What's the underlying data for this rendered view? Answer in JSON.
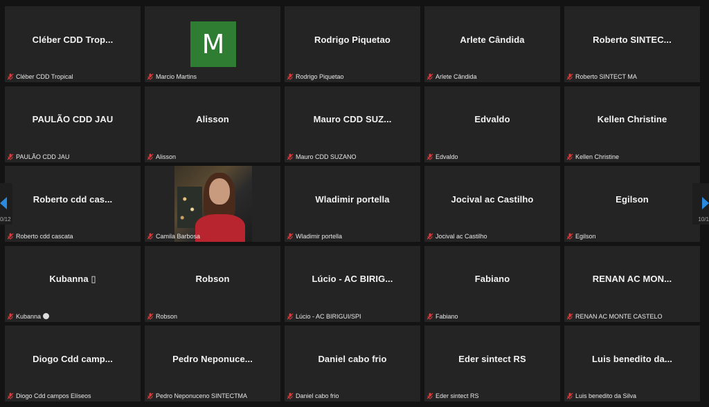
{
  "participants": [
    {
      "title": "Cléber CDD Trop...",
      "label": "Cléber CDD Tropical",
      "muted": true
    },
    {
      "title": "",
      "label": "Marcio Martins",
      "muted": true,
      "avatar_letter": "M",
      "avatar_color": "#2e7d32"
    },
    {
      "title": "Rodrigo Piquetao",
      "label": "Rodrigo Piquetao",
      "muted": true
    },
    {
      "title": "Arlete Cândida",
      "label": "Arlete Cândida",
      "muted": true
    },
    {
      "title": "Roberto  SINTEC...",
      "label": "Roberto SINTECT MA",
      "muted": true
    },
    {
      "title": "PAULÃO CDD JAU",
      "label": "PAULÃO CDD JAU",
      "muted": true
    },
    {
      "title": "Alisson",
      "label": "Alisson",
      "muted": true
    },
    {
      "title": "Mauro  CDD  SUZ...",
      "label": "Mauro CDD SUZANO",
      "muted": true
    },
    {
      "title": "Edvaldo",
      "label": "Edvaldo",
      "muted": true
    },
    {
      "title": "Kellen Christine",
      "label": "Kellen Christine",
      "muted": true
    },
    {
      "title": "Roberto cdd cas...",
      "label": "Roberto cdd cascata",
      "muted": true
    },
    {
      "title": "",
      "label": "Camila Barbosa",
      "muted": true,
      "video": true
    },
    {
      "title": "Wladimir portella",
      "label": "Wladimir portella",
      "muted": true
    },
    {
      "title": "Jocival ac Castilho",
      "label": "Jocival ac Castilho",
      "muted": true
    },
    {
      "title": "Egilson",
      "label": "Egilson",
      "muted": true
    },
    {
      "title": "Kubanna ▯",
      "label": "Kubanna",
      "muted": true,
      "badge": true
    },
    {
      "title": "Robson",
      "label": "Robson",
      "muted": true
    },
    {
      "title": "Lúcio - AC BIRIG...",
      "label": "Lúcio - AC BIRIGUI/SPI",
      "muted": true
    },
    {
      "title": "Fabiano",
      "label": "Fabiano",
      "muted": true
    },
    {
      "title": "RENAN  AC  MON...",
      "label": "RENAN AC MONTE CASTELO",
      "muted": true
    },
    {
      "title": "Diogo  Cdd  camp...",
      "label": "Diogo Cdd campos Elíseos",
      "muted": true
    },
    {
      "title": "Pedro  Neponuce...",
      "label": "Pedro Neponuceno SINTECTMA",
      "muted": true
    },
    {
      "title": "Daniel cabo frio",
      "label": "Daniel cabo frio",
      "muted": true
    },
    {
      "title": "Eder sintect RS",
      "label": "Eder sintect RS",
      "muted": true
    },
    {
      "title": "Luis  benedito  da...",
      "label": "Luis benedito da Silva",
      "muted": true
    }
  ],
  "nav": {
    "prev_page": "0/12",
    "next_page": "10/1",
    "arrow_color": "#2a8ae0"
  },
  "colors": {
    "tile_bg": "#242424",
    "muted_icon": "#e03c3c"
  }
}
